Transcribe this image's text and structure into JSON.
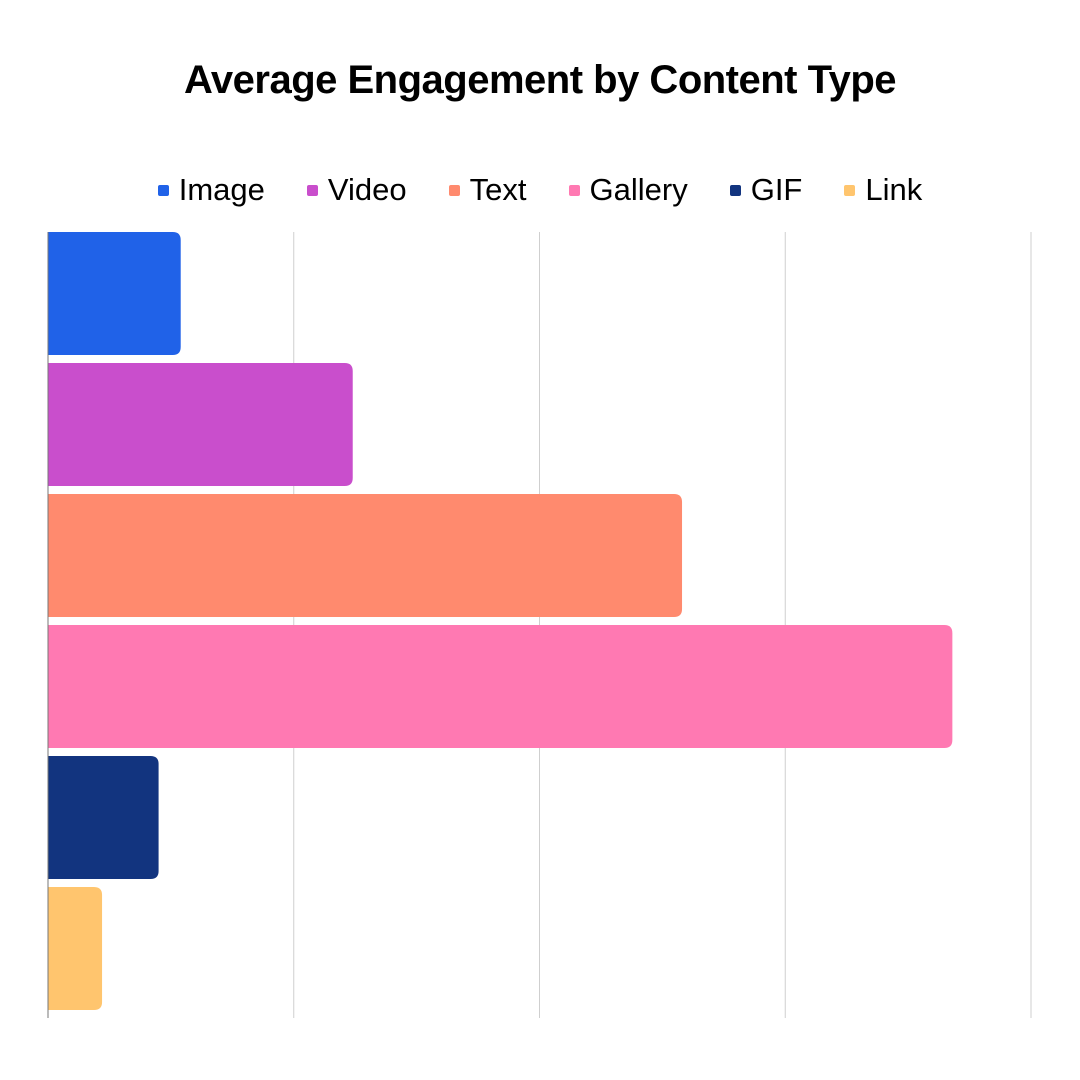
{
  "chart_data": {
    "type": "bar",
    "orientation": "horizontal",
    "title": "Average Engagement by Content Type",
    "xlabel": "",
    "ylabel": "",
    "categories": [
      "Image",
      "Video",
      "Text",
      "Gallery",
      "GIF",
      "Link"
    ],
    "values": [
      0.54,
      1.24,
      2.58,
      3.68,
      0.45,
      0.22
    ],
    "colors": [
      "#2062E8",
      "#C94ECC",
      "#FF8A6E",
      "#FF79B2",
      "#12347F",
      "#FFC56E"
    ],
    "xlim": [
      0,
      4
    ],
    "gridlines": [
      1,
      2,
      3,
      4
    ],
    "grid": true,
    "tick_labels_visible": false,
    "legend_position": "top",
    "legend": [
      "Image",
      "Video",
      "Text",
      "Gallery",
      "GIF",
      "Link"
    ]
  }
}
